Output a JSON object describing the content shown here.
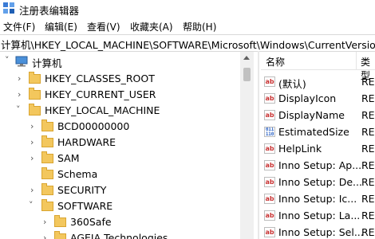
{
  "window": {
    "title": "注册表编辑器"
  },
  "menu": [
    "文件(F)",
    "编辑(E)",
    "查看(V)",
    "收藏夹(A)",
    "帮助(H)"
  ],
  "address": "计算机\\HKEY_LOCAL_MACHINE\\SOFTWARE\\Microsoft\\Windows\\CurrentVersion\\U",
  "tree": {
    "root": "计算机",
    "items": [
      {
        "label": "HKEY_CLASSES_ROOT",
        "expanded": false
      },
      {
        "label": "HKEY_CURRENT_USER",
        "expanded": false
      },
      {
        "label": "HKEY_LOCAL_MACHINE",
        "expanded": true
      },
      {
        "label": "BCD00000000",
        "expanded": false
      },
      {
        "label": "HARDWARE",
        "expanded": false
      },
      {
        "label": "SAM",
        "expanded": false
      },
      {
        "label": "Schema",
        "expanded": false
      },
      {
        "label": "SECURITY",
        "expanded": false
      },
      {
        "label": "SOFTWARE",
        "expanded": true
      },
      {
        "label": "360Safe",
        "expanded": false
      },
      {
        "label": "AGEIA Technologies",
        "expanded": false
      }
    ]
  },
  "list": {
    "columns": {
      "name": "名称",
      "type": "类型"
    },
    "rows": [
      {
        "name": "(默认)",
        "type": "REG",
        "icon": "string-value-icon"
      },
      {
        "name": "DisplayIcon",
        "type": "REG",
        "icon": "string-value-icon"
      },
      {
        "name": "DisplayName",
        "type": "REG",
        "icon": "string-value-icon"
      },
      {
        "name": "EstimatedSize",
        "type": "REG",
        "icon": "binary-value-icon"
      },
      {
        "name": "HelpLink",
        "type": "REG",
        "icon": "string-value-icon"
      },
      {
        "name": "Inno Setup: Ap...",
        "type": "REG",
        "icon": "string-value-icon"
      },
      {
        "name": "Inno Setup: De...",
        "type": "REG",
        "icon": "string-value-icon"
      },
      {
        "name": "Inno Setup: Ic...",
        "type": "REG",
        "icon": "string-value-icon"
      },
      {
        "name": "Inno Setup: La...",
        "type": "REG",
        "icon": "string-value-icon"
      },
      {
        "name": "Inno Setup: Sel...",
        "type": "REG",
        "icon": "string-value-icon"
      }
    ]
  }
}
